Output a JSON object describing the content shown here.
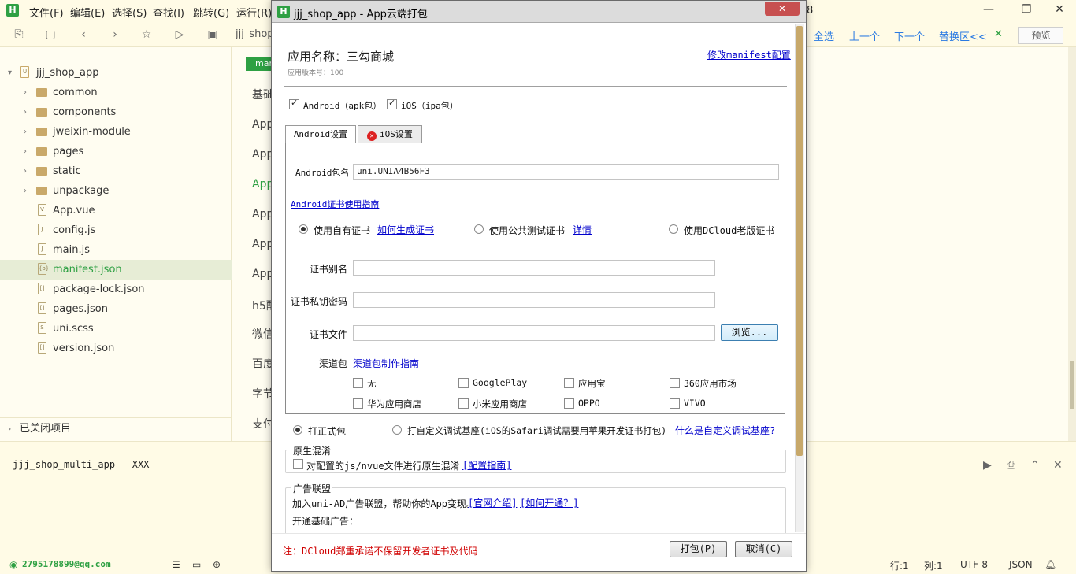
{
  "editor": {
    "app_badge": "H",
    "menu": [
      "文件(F)",
      "编辑(E)",
      "选择(S)",
      "查找(I)",
      "跳转(G)",
      "运行(R)"
    ],
    "title_tail": "8",
    "breadcrumb_project": "jjj_shop",
    "toolbar_right": [
      "全选",
      "上一个",
      "下一个",
      "替换区<<"
    ],
    "preview_label": "预览",
    "root_project": "jjj_shop_app",
    "tree": [
      {
        "label": "common",
        "type": "folder"
      },
      {
        "label": "components",
        "type": "folder"
      },
      {
        "label": "jweixin-module",
        "type": "folder"
      },
      {
        "label": "pages",
        "type": "folder"
      },
      {
        "label": "static",
        "type": "folder"
      },
      {
        "label": "unpackage",
        "type": "folder"
      },
      {
        "label": "App.vue",
        "type": "file",
        "icon": "V"
      },
      {
        "label": "config.js",
        "type": "file",
        "icon": "J"
      },
      {
        "label": "main.js",
        "type": "file",
        "icon": "J"
      },
      {
        "label": "manifest.json",
        "type": "file",
        "icon": "{o}"
      },
      {
        "label": "package-lock.json",
        "type": "file",
        "icon": "[]"
      },
      {
        "label": "pages.json",
        "type": "file",
        "icon": "[]"
      },
      {
        "label": "uni.scss",
        "type": "file",
        "icon": "S"
      },
      {
        "label": "version.json",
        "type": "file",
        "icon": "[]"
      }
    ],
    "closed_projects": "已关闭项目",
    "editor_chip": "mar",
    "outline": [
      "基础",
      "App",
      "App",
      "App",
      "App",
      "App",
      "App",
      "h5配",
      "微信",
      "百度",
      "字节",
      "支付"
    ],
    "console_tab": "jjj_shop_multi_app - XXX",
    "status_user": "2795178899@qq.com",
    "status_right": [
      "行:1",
      "列:1",
      "UTF-8",
      "JSON"
    ]
  },
  "dialog": {
    "badge": "H",
    "title": "jjj_shop_app - App云端打包",
    "close_label": "✕",
    "app_name": "应用名称：三勾商城",
    "app_version": "应用版本号：100",
    "manifest_link": "修改manifest配置",
    "platforms": [
      {
        "label": "Android（apk包）",
        "checked": true
      },
      {
        "label": "iOS（ipa包）",
        "checked": true
      }
    ],
    "tabs": [
      "Android设置",
      "iOS设置"
    ],
    "error_icon_glyph": "✕",
    "android": {
      "package_label": "Android包名",
      "package_value": "uni.UNIA4B56F3",
      "cert_guide_link": "Android证书使用指南",
      "cert_options": [
        {
          "label": "使用自有证书",
          "checked": true,
          "link": "如何生成证书"
        },
        {
          "label": "使用公共测试证书",
          "checked": false,
          "link": "详情"
        },
        {
          "label": "使用DCloud老版证书",
          "checked": false
        }
      ],
      "alias_label": "证书别名",
      "password_label": "证书私钥密码",
      "file_label": "证书文件",
      "browse_label": "浏览...",
      "channel_label": "渠道包",
      "channel_link": "渠道包制作指南",
      "channels": [
        {
          "label": "无",
          "checked": false
        },
        {
          "label": "GooglePlay",
          "checked": false
        },
        {
          "label": "应用宝",
          "checked": false
        },
        {
          "label": "360应用市场",
          "checked": false
        },
        {
          "label": "华为应用商店",
          "checked": false
        },
        {
          "label": "小米应用商店",
          "checked": false
        },
        {
          "label": "OPPO",
          "checked": false
        },
        {
          "label": "VIVO",
          "checked": false
        }
      ]
    },
    "build_modes": [
      {
        "label": "打正式包",
        "checked": true
      },
      {
        "label": "打自定义调试基座(iOS的Safari调试需要用苹果开发证书打包)",
        "checked": false
      }
    ],
    "custom_base_link": "什么是自定义调试基座?",
    "obfuscation": {
      "title": "原生混淆",
      "option": "对配置的js/nvue文件进行原生混淆",
      "link": "[配置指南]"
    },
    "ads": {
      "title": "广告联盟",
      "intro": "加入uni-AD广告联盟，帮助你的App变现。",
      "link1": "[官网介绍]",
      "link2": "[如何开通？]",
      "basic": "开通基础广告："
    },
    "note": "注：DCloud郑重承诺不保留开发者证书及代码",
    "pack_button": "打包(P)",
    "cancel_button": "取消(C)"
  },
  "colors": {
    "accent": "#2ea043",
    "link": "#0000cc",
    "warning": "#d00000"
  }
}
